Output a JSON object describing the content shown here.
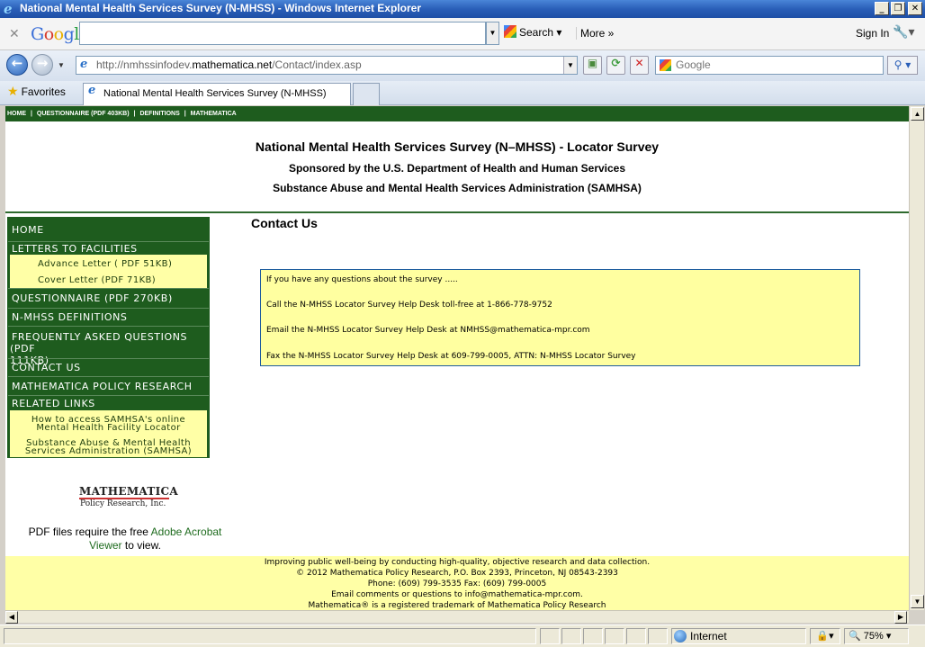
{
  "window": {
    "title": "National Mental Health Services Survey (N-MHSS) - Windows Internet Explorer",
    "minimize": "_",
    "maximize": "❐",
    "close": "✕"
  },
  "google_toolbar": {
    "close_glyph": "✕",
    "logo": "Google",
    "search_value": "",
    "search_label": "Search",
    "more_label": "More »",
    "signin_label": "Sign In",
    "wrench_glyph": "🔧"
  },
  "navbar": {
    "address_prefix": "http://nmhssinfodev.",
    "address_host": "mathematica.net",
    "address_path": "/Contact/index.asp",
    "live_search_placeholder": "Google",
    "search_go_glyph": "⚲"
  },
  "favbar": {
    "favorites_label": "Favorites",
    "tab_title": "National Mental Health Services Survey (N-MHSS)"
  },
  "page": {
    "topnav": [
      "HOME",
      "|",
      "QUESTIONNAIRE (PDF 403KB)",
      "|",
      "DEFINITIONS",
      "|",
      "MATHEMATICA"
    ],
    "header": {
      "title": "National Mental Health Services Survey (N–MHSS) - Locator Survey",
      "sponsor": "Sponsored by the U.S. Department of Health and Human Services",
      "agency": "Substance Abuse and Mental Health Services Administration (SAMHSA)"
    },
    "menu": {
      "home": "HOME",
      "letters": "LETTERS TO FACILITIES",
      "advance_letter": "Advance Letter ( PDF 51KB)",
      "cover_letter": "Cover Letter (PDF 71KB)",
      "questionnaire": "QUESTIONNAIRE (PDF 270KB)",
      "definitions": "N-MHSS DEFINITIONS",
      "faq_line1": "FREQUENTLY ASKED QUESTIONS (PDF",
      "faq_line2": "111KB)",
      "contact": "CONTACT US",
      "mathematica": "MATHEMATICA POLICY RESEARCH",
      "related": "RELATED LINKS",
      "link1_line1": "How to access SAMHSA's online",
      "link1_line2": "Mental Health Facility Locator",
      "link2_line1": "Substance Abuse & Mental Health",
      "link2_line2": "Services Administration (SAMHSA)"
    },
    "logo": {
      "name": "MATHEMATICA",
      "subtitle": "Policy Research, Inc."
    },
    "pdf_note": {
      "before": "PDF files require the free ",
      "link1": "Adobe Acrobat",
      "link2": "Viewer",
      "after": " to view."
    },
    "contact": {
      "title": "Contact Us",
      "line1": "If you have any questions about the survey .....",
      "line2": "Call the N-MHSS Locator Survey Help Desk toll-free at 1-866-778-9752",
      "line3": "Email the N-MHSS Locator Survey Help Desk at NMHSS@mathematica-mpr.com",
      "line4": "Fax the N-MHSS Locator Survey Help Desk at 609-799-0005, ATTN: N-MHSS Locator Survey"
    },
    "footer": {
      "line1": "Improving public well-being by conducting high-quality, objective research and data collection.",
      "line2": "© 2012 Mathematica Policy Research, P.O. Box 2393, Princeton, NJ 08543-2393",
      "line3": "Phone: (609) 799-3535 Fax: (609) 799-0005",
      "line4": "Email comments or questions to info@mathematica-mpr.com.",
      "line5": "Mathematica® is a registered trademark of Mathematica Policy Research"
    }
  },
  "statusbar": {
    "zone": "Internet",
    "protected_glyph": "🔒▾",
    "zoom": "75%"
  },
  "colors": {
    "nav_green": "#1e5c1e",
    "menu_yellow": "#ffffa6",
    "titlebar_blue": "#2a5fb8"
  }
}
